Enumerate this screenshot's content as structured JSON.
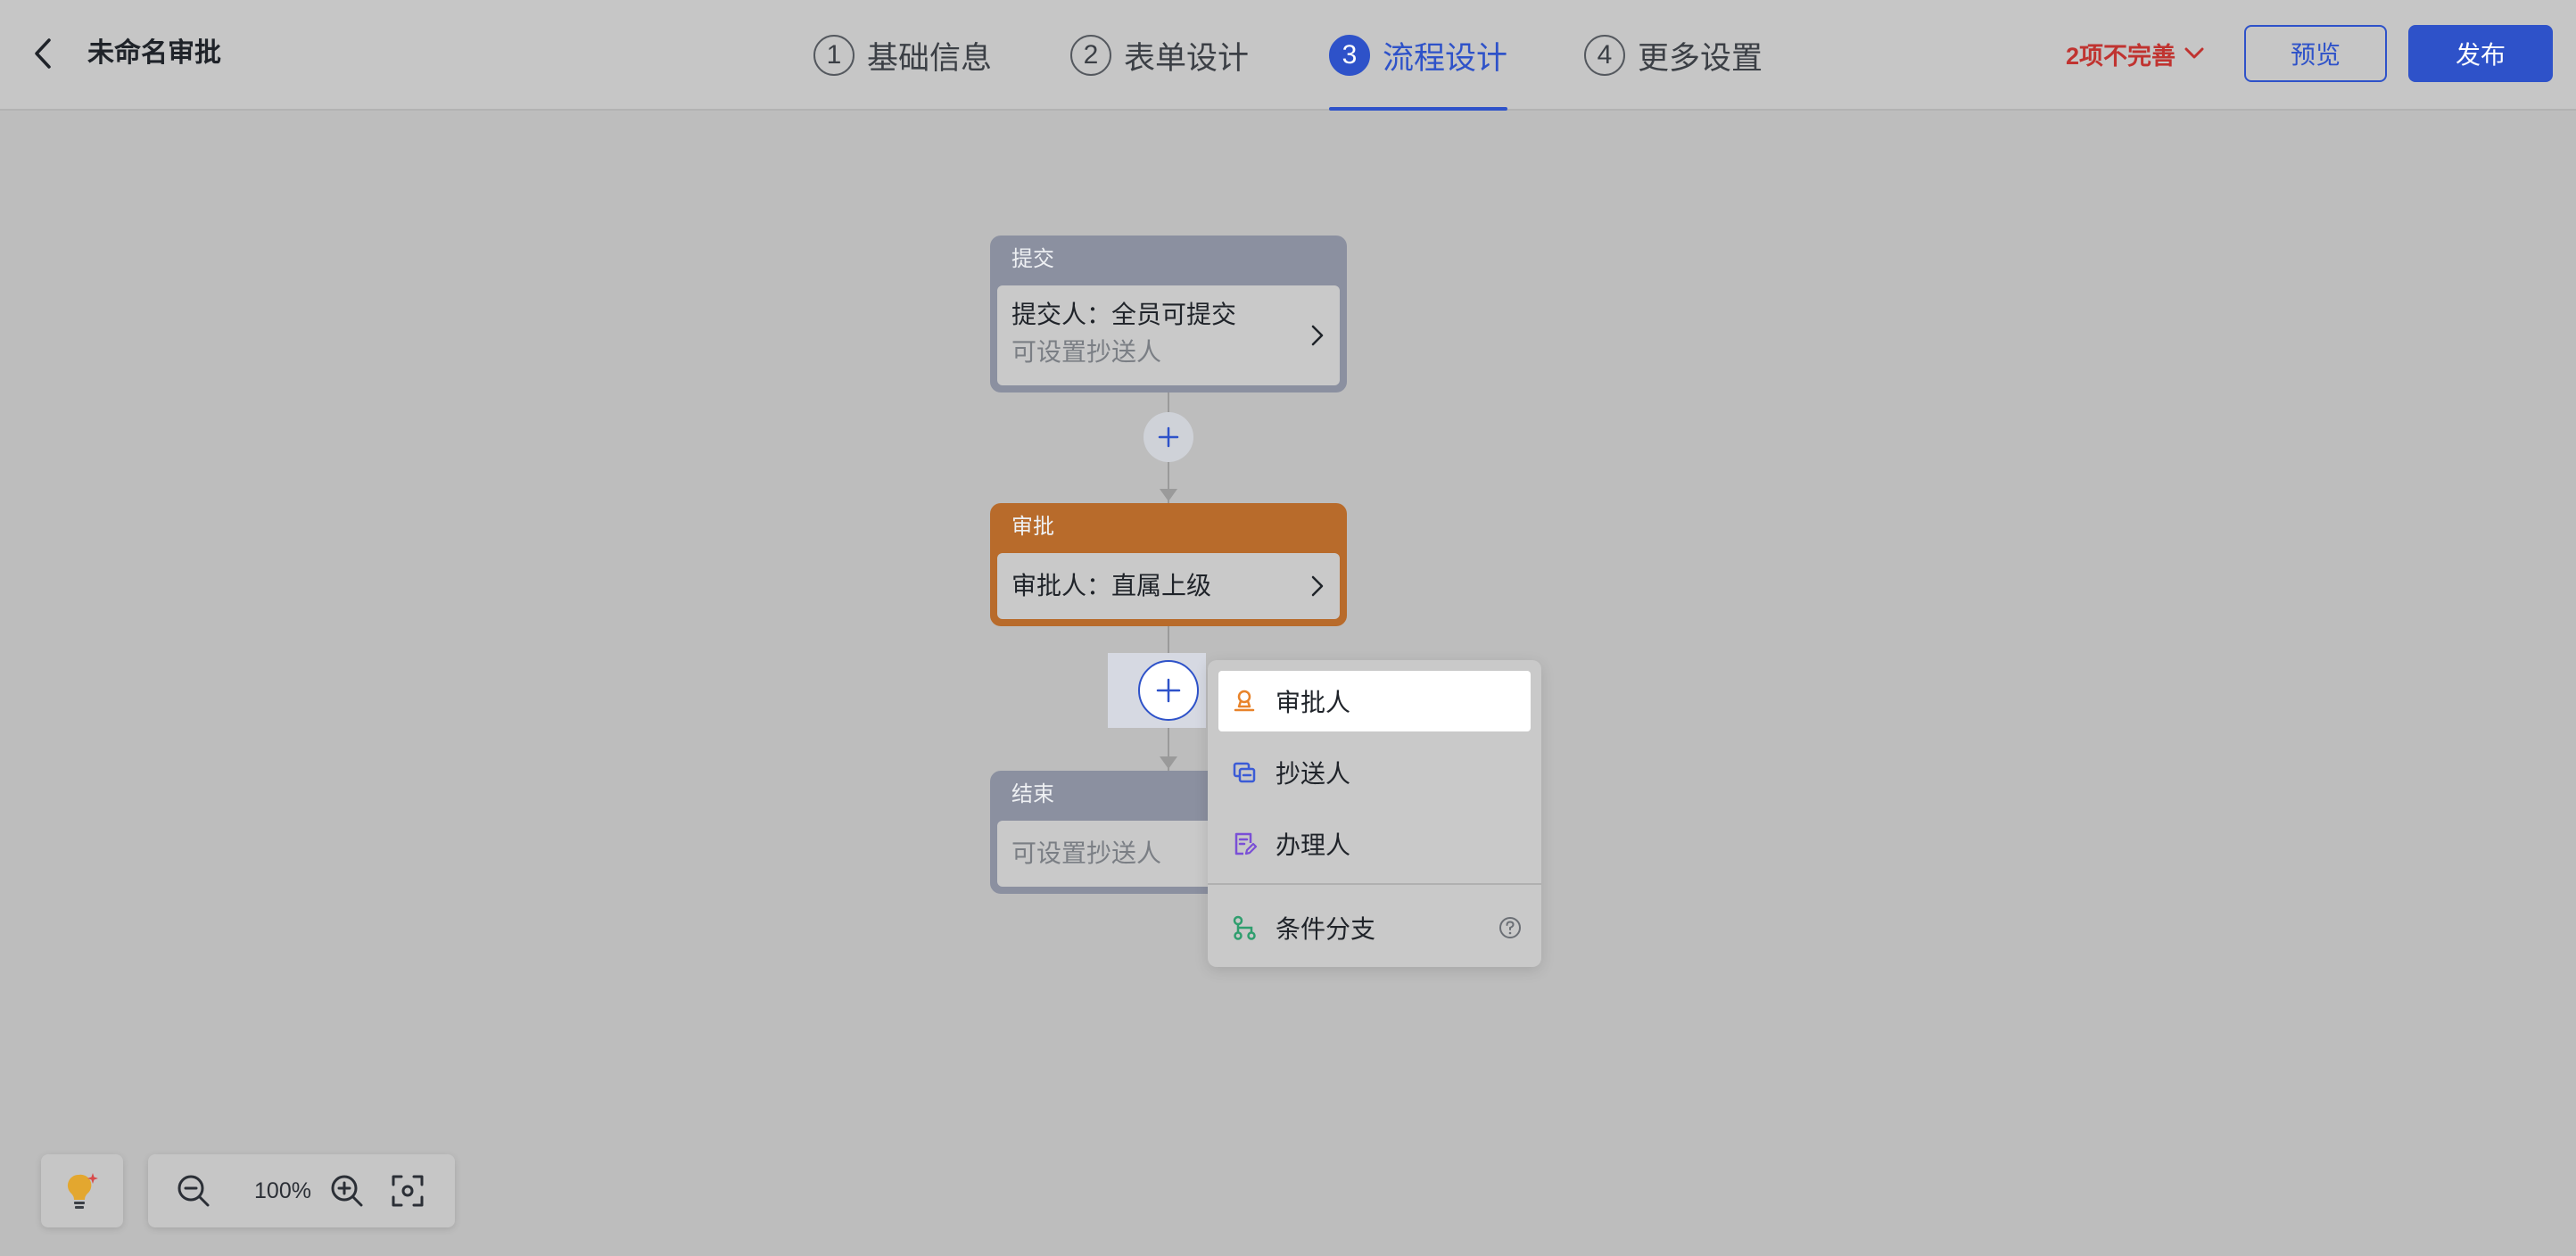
{
  "header": {
    "title": "未命名审批",
    "steps": [
      {
        "num": "1",
        "label": "基础信息"
      },
      {
        "num": "2",
        "label": "表单设计"
      },
      {
        "num": "3",
        "label": "流程设计"
      },
      {
        "num": "4",
        "label": "更多设置"
      }
    ],
    "active_step": "3",
    "warning": "2项不完善",
    "preview_label": "预览",
    "publish_label": "发布"
  },
  "flow": {
    "submit": {
      "title": "提交",
      "line1": "提交人：全员可提交",
      "line2": "可设置抄送人"
    },
    "approve": {
      "title": "审批",
      "line1": "审批人：直属上级"
    },
    "end": {
      "title": "结束",
      "line1": "可设置抄送人"
    }
  },
  "dropdown": {
    "items": [
      {
        "label": "审批人",
        "icon": "approver-stamp-icon"
      },
      {
        "label": "抄送人",
        "icon": "cc-icon"
      },
      {
        "label": "办理人",
        "icon": "handler-edit-icon"
      },
      {
        "label": "条件分支",
        "icon": "branch-icon"
      }
    ]
  },
  "toolbar": {
    "zoom": "100%"
  },
  "colors": {
    "accent": "#2e52c9",
    "warning": "#c03330",
    "approve_node": "#b86b2b",
    "submit_node": "#8b90a0"
  }
}
